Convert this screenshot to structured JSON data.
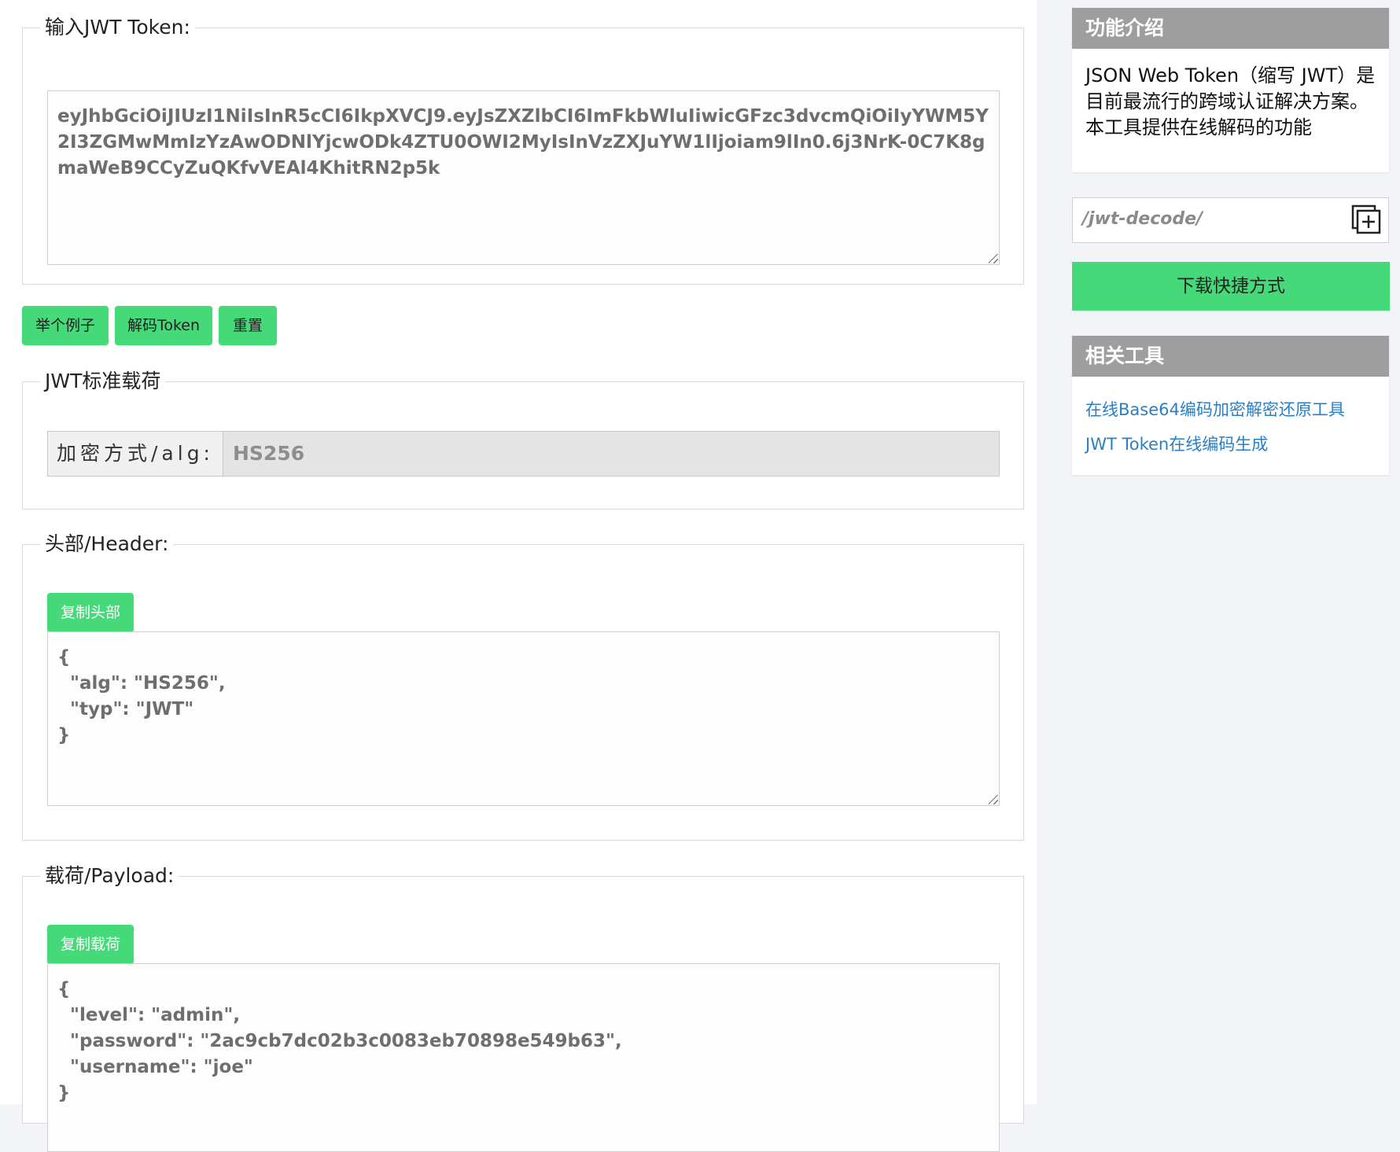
{
  "token_section": {
    "legend": "输入JWT Token:",
    "token_value": "eyJhbGciOiJIUzI1NiIsInR5cCI6IkpXVCJ9.eyJsZXZlbCI6ImFkbWluIiwicGFzc3dvcmQiOiIyYWM5Y2I3ZGMwMmIzYzAwODNlYjcwODk4ZTU0OWI2MyIsInVzZXJuYW1lIjoiam9lIn0.6j3NrK-0C7K8gmaWeB9CCyZuQKfvVEAl4KhitRN2p5k"
  },
  "actions": {
    "example_label": "举个例子",
    "decode_label": "解码Token",
    "reset_label": "重置"
  },
  "claims_section": {
    "legend": "JWT标准载荷",
    "alg_label": "加密方式/alg:",
    "alg_value": "HS256"
  },
  "header_section": {
    "legend": "头部/Header:",
    "copy_label": "复制头部",
    "content": "{\n  \"alg\": \"HS256\",\n  \"typ\": \"JWT\"\n}"
  },
  "payload_section": {
    "legend": "载荷/Payload:",
    "copy_label": "复制载荷",
    "content": "{\n  \"level\": \"admin\",\n  \"password\": \"2ac9cb7dc02b3c0083eb70898e549b63\",\n  \"username\": \"joe\"\n}"
  },
  "sidebar": {
    "intro_title": "功能介绍",
    "intro_text": "JSON Web Token（缩写 JWT）是目前最流行的跨域认证解决方案。本工具提供在线解码的功能",
    "path_value": "/jwt-decode/",
    "path_icon": "add-bookmark-icon",
    "download_label": "下载快捷方式",
    "related_title": "相关工具",
    "related_links": [
      "在线Base64编码加密解密还原工具",
      "JWT Token在线编码生成"
    ]
  },
  "colors": {
    "accent_green": "#46d97a",
    "sidebar_header_gray": "#9e9e9e",
    "link_blue": "#2a7fc4"
  }
}
